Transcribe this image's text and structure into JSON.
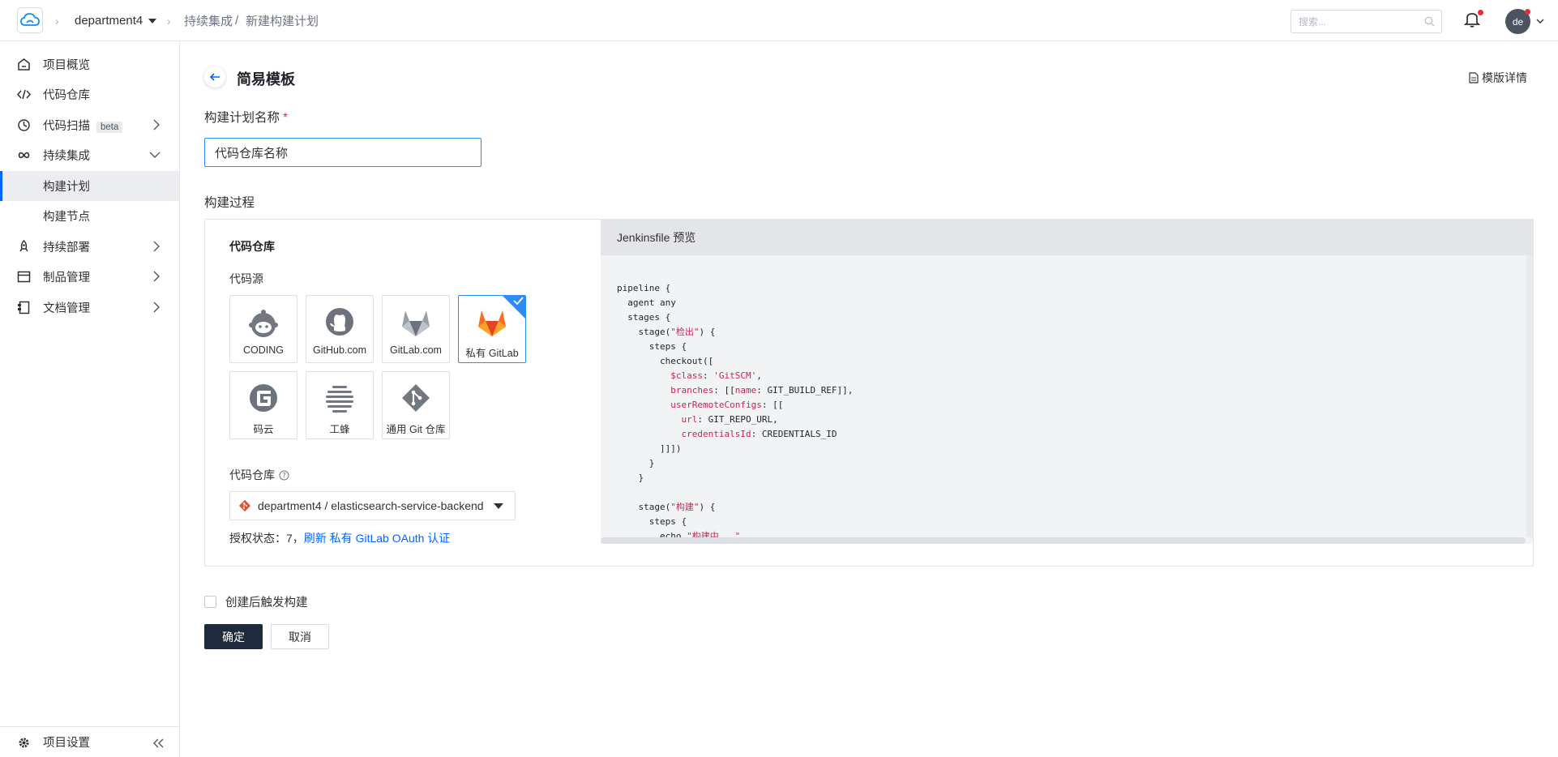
{
  "topbar": {
    "project": "department4",
    "crumb_ci": "持续集成",
    "crumb_sep": "/",
    "crumb_new": "新建构建计划",
    "search_placeholder": "搜索...",
    "avatar_text": "de"
  },
  "sidebar": {
    "items": [
      {
        "label": "项目概览",
        "icon": "home-icon"
      },
      {
        "label": "代码仓库",
        "icon": "code-icon"
      },
      {
        "label": "代码扫描",
        "badge": "beta",
        "icon": "scan-icon"
      },
      {
        "label": "持续集成",
        "icon": "infinity-icon"
      },
      {
        "label": "构建计划"
      },
      {
        "label": "构建节点"
      },
      {
        "label": "持续部署",
        "icon": "rocket-icon"
      },
      {
        "label": "制品管理",
        "icon": "box-icon"
      },
      {
        "label": "文档管理",
        "icon": "doc-icon"
      }
    ],
    "settings_label": "项目设置"
  },
  "main": {
    "title": "简易模板",
    "template_detail": "模版详情",
    "name_label": "构建计划名称",
    "required_mark": "*",
    "name_value": "代码仓库名称",
    "process_label": "构建过程",
    "repo_section_title": "代码仓库",
    "source_label": "代码源",
    "sources": [
      {
        "name": "CODING",
        "icon": "coding-icon"
      },
      {
        "name": "GitHub.com",
        "icon": "github-icon"
      },
      {
        "name": "GitLab.com",
        "icon": "gitlab-icon"
      },
      {
        "name": "私有 GitLab",
        "icon": "gitlab-private-icon",
        "selected": true
      },
      {
        "name": "码云",
        "icon": "gitee-icon"
      },
      {
        "name": "工蜂",
        "icon": "gongfeng-icon"
      },
      {
        "name": "通用 Git 仓库",
        "icon": "git-icon"
      }
    ],
    "repo_label": "代码仓库",
    "repo_value": "department4 / elasticsearch-service-backend",
    "auth_prefix": "授权状态：7，",
    "auth_link": "刷新 私有 GitLab OAuth 认证",
    "preview_title": "Jenkinsfile 预览",
    "trigger_label": "创建后触发构建",
    "confirm_label": "确定",
    "cancel_label": "取消"
  },
  "colors": {
    "accent": "#0066ff",
    "primary_button": "#1f2b3d",
    "selected_border": "#2c8cf4"
  }
}
